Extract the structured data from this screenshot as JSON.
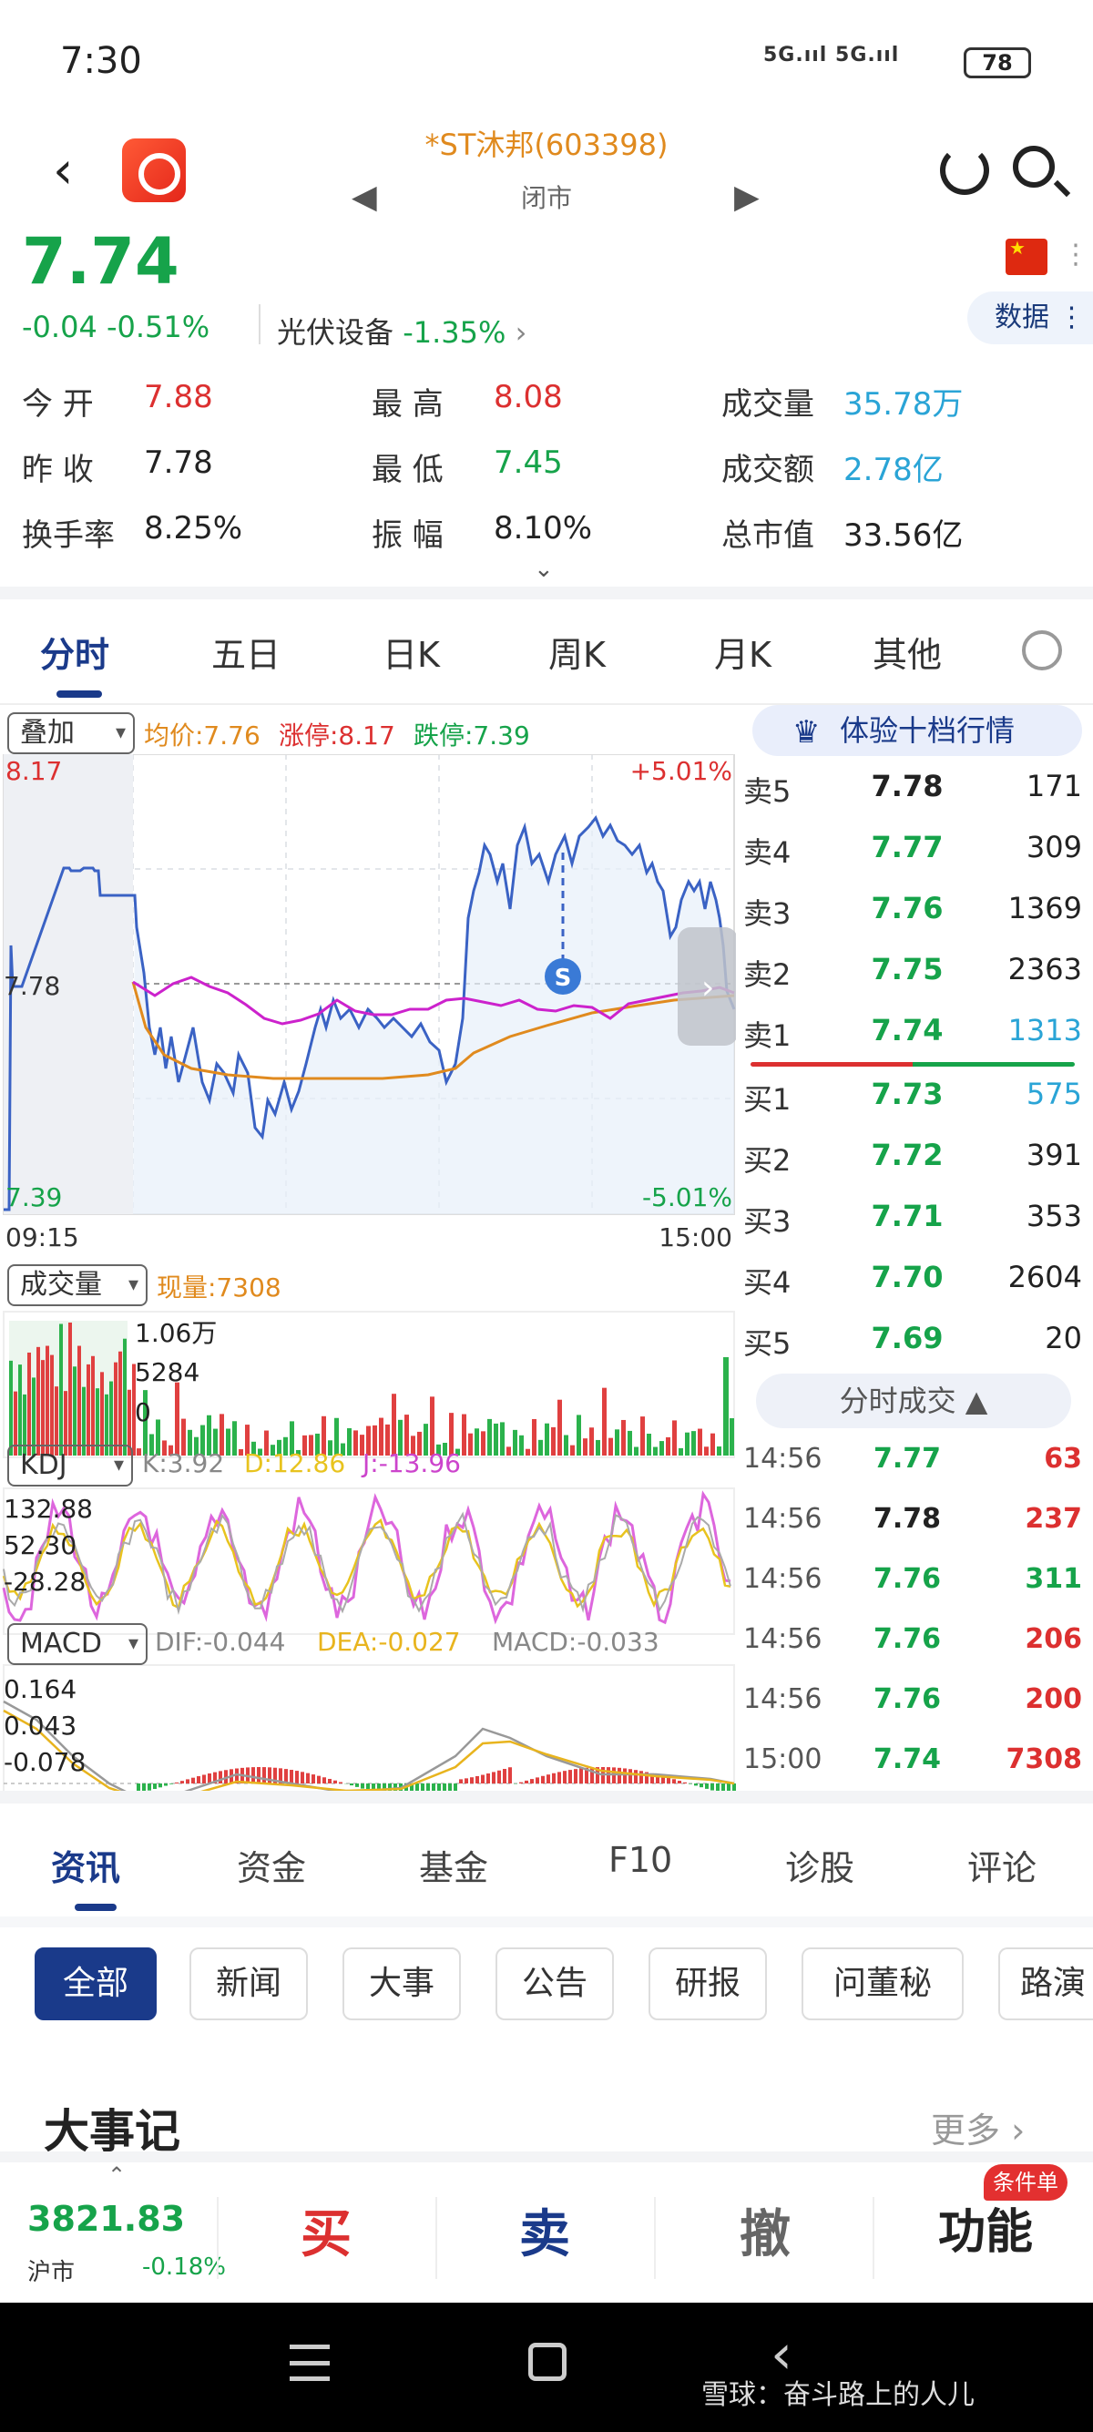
{
  "status_bar": {
    "time": "7:30",
    "signal": "5G.ııl 5G.ııl",
    "battery": "78"
  },
  "header": {
    "title": "*ST沐邦(603398)",
    "market_status": "闭市"
  },
  "quote": {
    "price": "7.74",
    "change": "-0.04  -0.51%",
    "sector": "光伏设备",
    "sector_change": "-1.35%",
    "data_button": "数据"
  },
  "stats": {
    "open_label": "今  开",
    "open": "7.88",
    "high_label": "最  高",
    "high": "8.08",
    "volume_label": "成交量",
    "volume": "35.78万",
    "prev_label": "昨  收",
    "prev": "7.78",
    "low_label": "最  低",
    "low": "7.45",
    "amount_label": "成交额",
    "amount": "2.78亿",
    "turnover_label": "换手率",
    "turnover": "8.25%",
    "amplitude_label": "振  幅",
    "amplitude": "8.10%",
    "mktcap_label": "总市值",
    "mktcap": "33.56亿"
  },
  "chart_tabs": [
    "分时",
    "五日",
    "日K",
    "周K",
    "月K",
    "其他"
  ],
  "intraday": {
    "overlay_label": "叠加",
    "avg_price": "均价:7.76",
    "limit_up": "涨停:8.17",
    "limit_down": "跌停:7.39",
    "top_price": "8.17",
    "mid_price": "7.78",
    "bottom_price": "7.39",
    "top_pct": "+5.01%",
    "bottom_pct": "-5.01%",
    "time_start": "09:15",
    "time_end": "15:00",
    "marker": "S"
  },
  "volume_panel": {
    "label": "成交量",
    "current": "现量:7308",
    "tick_top": "1.06万",
    "tick_mid": "5284",
    "tick_zero": "0"
  },
  "kdj_panel": {
    "label": "KDJ",
    "k": "K:3.92",
    "d": "D:12.86",
    "j": "J:-13.96",
    "tick_top": "132.88",
    "tick_mid": "52.30",
    "tick_bot": "-28.28"
  },
  "macd_panel": {
    "label": "MACD",
    "dif": "DIF:-0.044",
    "dea": "DEA:-0.027",
    "macd": "MACD:-0.033",
    "tick_top": "0.164",
    "tick_mid": "0.043",
    "tick_bot": "-0.078"
  },
  "order_book": {
    "upgrade_label": "体验十档行情",
    "asks": [
      {
        "label": "卖5",
        "price": "7.78",
        "volume": "171"
      },
      {
        "label": "卖4",
        "price": "7.77",
        "volume": "309"
      },
      {
        "label": "卖3",
        "price": "7.76",
        "volume": "1369"
      },
      {
        "label": "卖2",
        "price": "7.75",
        "volume": "2363"
      },
      {
        "label": "卖1",
        "price": "7.74",
        "volume": "1313"
      }
    ],
    "bids": [
      {
        "label": "买1",
        "price": "7.73",
        "volume": "575"
      },
      {
        "label": "买2",
        "price": "7.72",
        "volume": "391"
      },
      {
        "label": "买3",
        "price": "7.71",
        "volume": "353"
      },
      {
        "label": "买4",
        "price": "7.70",
        "volume": "2604"
      },
      {
        "label": "买5",
        "price": "7.69",
        "volume": "20"
      }
    ],
    "trades_label": "分时成交 ▲",
    "trades": [
      {
        "time": "14:56",
        "price": "7.77",
        "volume": "63"
      },
      {
        "time": "14:56",
        "price": "7.78",
        "volume": "237"
      },
      {
        "time": "14:56",
        "price": "7.76",
        "volume": "311"
      },
      {
        "time": "14:56",
        "price": "7.76",
        "volume": "206"
      },
      {
        "time": "14:56",
        "price": "7.76",
        "volume": "200"
      },
      {
        "time": "15:00",
        "price": "7.74",
        "volume": "7308"
      }
    ]
  },
  "news_tabs": [
    "资讯",
    "资金",
    "基金",
    "F10",
    "诊股",
    "评论"
  ],
  "news_chips": [
    "全部",
    "新闻",
    "大事",
    "公告",
    "研报",
    "问董秘",
    "路演"
  ],
  "events": {
    "title": "大事记",
    "more": "更多"
  },
  "bottom_bar": {
    "index_value": "3821.83",
    "index_name": "沪市",
    "index_change": "-0.18%",
    "buy": "买",
    "sell": "卖",
    "cancel": "撤",
    "function": "功能",
    "function_badge": "条件单"
  },
  "watermark": "雪球：奋斗路上的人儿",
  "colors": {
    "up": "#dc3030",
    "down": "#16a34a",
    "accent": "#1a3a8a",
    "avg": "#e08a1e",
    "price_line": "#3a62c4",
    "overlay": "#cc22cc"
  }
}
